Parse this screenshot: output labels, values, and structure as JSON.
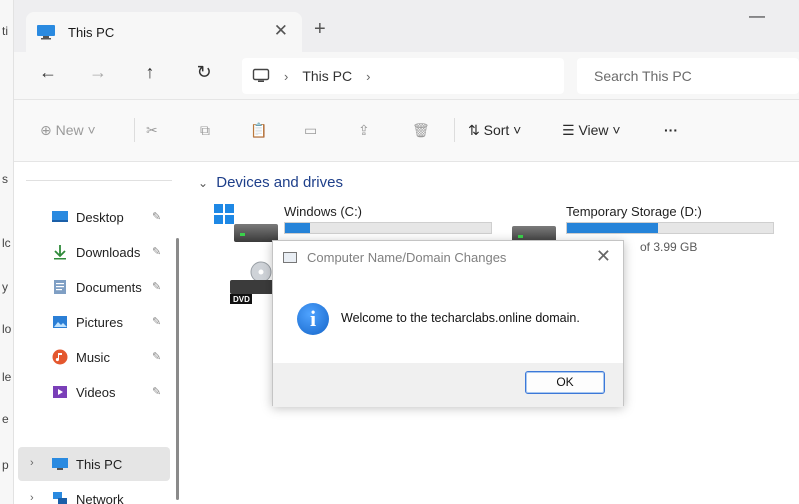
{
  "background_window": {
    "edge_letters": [
      "ti",
      "s",
      "lc",
      "y",
      "lo",
      "le",
      "e",
      "p"
    ]
  },
  "window": {
    "tab_title": "This PC",
    "tab_close": "✕",
    "new_tab": "+",
    "minimize": "—"
  },
  "nav": {
    "back": "←",
    "forward": "→",
    "up": "↑",
    "refresh": "↻"
  },
  "address": {
    "sep1": "›",
    "crumb": "This PC",
    "sep2": "›"
  },
  "search": {
    "placeholder": "Search This PC"
  },
  "toolbar": {
    "new_label": "⊕ New ˅",
    "sort_label": "⇅ Sort ˅",
    "view_label": "☰ View ˅",
    "more_label": "···",
    "cut": "✂",
    "copy": "⧉",
    "paste": "📋",
    "rename": "▭",
    "share": "⇪",
    "delete": "🗑"
  },
  "sidebar": {
    "items": [
      {
        "label": "Desktop",
        "pin": "✎",
        "icon": "desktop-icon"
      },
      {
        "label": "Downloads",
        "pin": "✎",
        "icon": "download-icon"
      },
      {
        "label": "Documents",
        "pin": "✎",
        "icon": "documents-icon"
      },
      {
        "label": "Pictures",
        "pin": "✎",
        "icon": "pictures-icon"
      },
      {
        "label": "Music",
        "pin": "✎",
        "icon": "music-icon"
      },
      {
        "label": "Videos",
        "pin": "✎",
        "icon": "videos-icon"
      }
    ],
    "this_pc": {
      "label": "This PC",
      "chev": "›"
    },
    "network": {
      "label": "Network",
      "chev": "›"
    }
  },
  "content": {
    "section_chev": "⌄",
    "section_title": "Devices and drives",
    "drives": [
      {
        "name": "Windows (C:)",
        "used_fraction": 0.12,
        "free_text": ""
      },
      {
        "name": "Temporary Storage (D:)",
        "used_fraction": 0.44,
        "free_text": "of 3.99 GB"
      }
    ],
    "dvd_label": "DVD"
  },
  "dialog": {
    "title": "Computer Name/Domain Changes",
    "close": "✕",
    "info_glyph": "i",
    "message": "Welcome to the techarclabs.online domain.",
    "ok_label": "OK"
  },
  "colors": {
    "accent": "#2684d9",
    "section_title": "#1e3f8a",
    "info_icon": "#1565c9"
  }
}
